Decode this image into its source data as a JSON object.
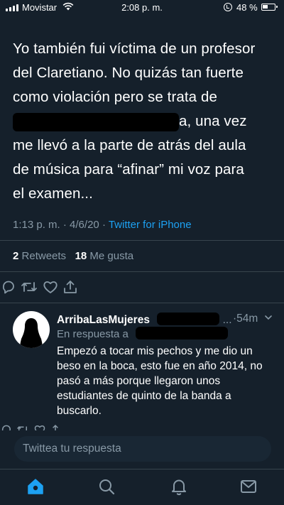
{
  "status_bar": {
    "carrier": "Movistar",
    "time": "2:08 p. m.",
    "battery": "48 %"
  },
  "tweet": {
    "lines": [
      "Yo también fui víctima de un profesor",
      "del Claretiano. No quizás tan fuerte",
      "como violación pero se trata de",
      "a, una vez",
      "me llevó a la parte de atrás del aula",
      "de música para “afinar” mi voz para",
      "el examen..."
    ],
    "time": "1:13 p. m.",
    "date": "4/6/20",
    "separator": "·",
    "source": "Twitter for iPhone",
    "retweets_count": "2",
    "retweets_label": "Retweets",
    "likes_count": "18",
    "likes_label": "Me gusta"
  },
  "reply": {
    "author": "ArribaLasMujeres",
    "time": "54m",
    "ellipsis": "...",
    "replying_to": "En respuesta a",
    "text": "Empezó a tocar mis pechos y me dio un beso en la boca, esto fue en año 2014, no pasó a más porque llegaron unos estudiantes de quinto de la banda a buscarlo."
  },
  "compose": {
    "placeholder": "Twittea tu respuesta"
  },
  "colors": {
    "background": "#15202b",
    "accent": "#1da1f2",
    "secondary_text": "#8899a6",
    "divider": "#38444d"
  },
  "icons": [
    "reply-icon",
    "retweet-icon",
    "like-icon",
    "share-icon",
    "home-icon",
    "search-icon",
    "notifications-icon",
    "messages-icon"
  ]
}
